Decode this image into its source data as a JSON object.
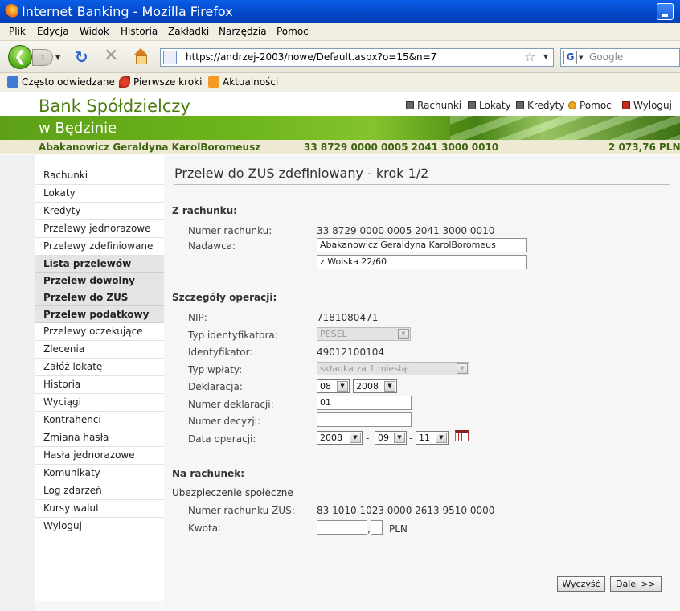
{
  "browser": {
    "window_title": "Internet Banking - Mozilla Firefox",
    "menu": [
      "Plik",
      "Edycja",
      "Widok",
      "Historia",
      "Zakładki",
      "Narzędzia",
      "Pomoc"
    ],
    "url": "https://andrzej-2003/nowe/Default.aspx?o=15&n=7",
    "search_placeholder": "Google",
    "search_engine_glyph": "G",
    "bookmarks": [
      "Często odwiedzane",
      "Pierwsze kroki",
      "Aktualności"
    ]
  },
  "header": {
    "bank_name": "Bank Spółdzielczy",
    "bank_city": "w Będzinie",
    "links": [
      "Rachunki",
      "Lokaty",
      "Kredyty",
      "Pomoc",
      "Wyloguj"
    ]
  },
  "account": {
    "holder": "Abakanowicz Geraldyna KarolBoromeusz",
    "number": "33 8729 0000 0005 2041 3000 0010",
    "balance": "2 073,76 PLN"
  },
  "sidebar": {
    "items": [
      {
        "label": "Rachunki",
        "section": false
      },
      {
        "label": "Lokaty",
        "section": false
      },
      {
        "label": "Kredyty",
        "section": false
      },
      {
        "label": "Przelewy jednorazowe",
        "section": false
      },
      {
        "label": "Przelewy zdefiniowane",
        "section": false
      },
      {
        "label": "Lista przelewów",
        "section": true
      },
      {
        "label": "Przelew dowolny",
        "section": true
      },
      {
        "label": "Przelew do ZUS",
        "section": true
      },
      {
        "label": "Przelew podatkowy",
        "section": true
      },
      {
        "label": "Przelewy oczekujące",
        "section": false
      },
      {
        "label": "Zlecenia",
        "section": false
      },
      {
        "label": "Załóż lokatę",
        "section": false
      },
      {
        "label": "Historia",
        "section": false
      },
      {
        "label": "Wyciągi",
        "section": false
      },
      {
        "label": "Kontrahenci",
        "section": false
      },
      {
        "label": "Zmiana hasła",
        "section": false
      },
      {
        "label": "Hasła jednorazowe",
        "section": false
      },
      {
        "label": "Komunikaty",
        "section": false
      },
      {
        "label": "Log zdarzeń",
        "section": false
      },
      {
        "label": "Kursy walut",
        "section": false
      },
      {
        "label": "Wyloguj",
        "section": false
      }
    ]
  },
  "form": {
    "title": "Przelew do ZUS zdefiniowany - krok 1/2",
    "from_section": {
      "heading": "Z rachunku:",
      "account_label": "Numer rachunku:",
      "account_value": "33 8729 0000 0005 2041 3000 0010",
      "sender_label": "Nadawca:",
      "sender_line1": "Abakanowicz Geraldyna KarolBoromeus",
      "sender_line2": "z  Woiska 22/60"
    },
    "details_section": {
      "heading": "Szczegóły operacji:",
      "nip_label": "NIP:",
      "nip_value": "7181080471",
      "id_type_label": "Typ identyfikatora:",
      "id_type_value": "PESEL",
      "id_label": "Identyfikator:",
      "id_value": "49012100104",
      "payment_type_label": "Typ wpłaty:",
      "payment_type_value": "składka za 1 miesiąc",
      "declaration_label": "Deklaracja:",
      "declaration_month": "08",
      "declaration_year": "2008",
      "declaration_number_label": "Numer deklaracji:",
      "declaration_number_value": "01",
      "decision_number_label": "Numer decyzji:",
      "decision_number_value": "",
      "operation_date_label": "Data operacji:",
      "operation_year": "2008",
      "operation_month": "09",
      "operation_day": "11",
      "date_separator": "-"
    },
    "to_section": {
      "heading": "Na rachunek:",
      "recipient_name": "Ubezpieczenie społeczne",
      "zus_account_label": "Numer rachunku ZUS:",
      "zus_account_value": "83 1010 1023 0000 2613 9510 0000",
      "amount_label": "Kwota:",
      "amount_whole": "",
      "amount_decimal_separator": ",",
      "amount_fraction": "",
      "currency": "PLN"
    },
    "buttons": {
      "clear": "Wyczyść",
      "next": "Dalej >>"
    }
  },
  "colors": {
    "brand_green": "#4b7c10",
    "titlebar_blue": "#0a5ee6",
    "account_bar": "#ede9d2"
  }
}
